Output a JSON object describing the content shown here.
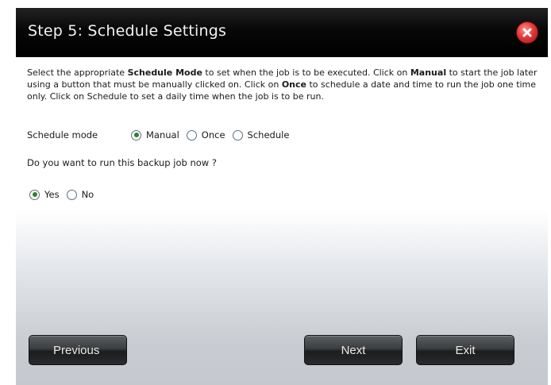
{
  "dialog": {
    "title": "Step 5: Schedule Settings",
    "close_icon": "close-icon",
    "description": {
      "p1": "Select the appropriate ",
      "b1": "Schedule Mode",
      "p2": " to set when the job is to be executed. Click on ",
      "b2": "Manual",
      "p3": " to start the job later using a button that must be manually clicked on. Click on ",
      "b3": "Once",
      "p4": " to schedule a date and time to run the job one time only. Click on Schedule to set a daily time when the job is to be run."
    },
    "schedule_mode": {
      "label": "Schedule mode",
      "options": [
        "Manual",
        "Once",
        "Schedule"
      ],
      "selected": "Manual"
    },
    "run_now": {
      "question": "Do you want to run this backup job now ?",
      "options": [
        "Yes",
        "No"
      ],
      "selected": "Yes"
    },
    "buttons": {
      "previous": "Previous",
      "next": "Next",
      "exit": "Exit"
    },
    "colors": {
      "titlebar": "#000000",
      "close_button": "#d93030",
      "radio_checked": "#2f7f33"
    }
  }
}
